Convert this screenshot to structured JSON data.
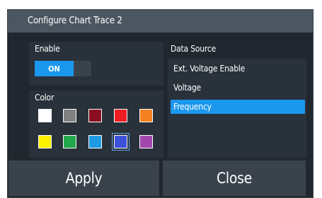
{
  "dialog": {
    "title": "Configure Chart Trace 2"
  },
  "enable": {
    "label": "Enable",
    "toggle_text": "ON",
    "state": true
  },
  "color": {
    "label": "Color",
    "swatches": [
      {
        "name": "white",
        "hex": "#ffffff"
      },
      {
        "name": "gray",
        "hex": "#808080"
      },
      {
        "name": "dark-red",
        "hex": "#8b0e1e"
      },
      {
        "name": "red",
        "hex": "#ee1d23"
      },
      {
        "name": "orange",
        "hex": "#f58220"
      },
      {
        "name": "yellow",
        "hex": "#fff200"
      },
      {
        "name": "green",
        "hex": "#21a84a"
      },
      {
        "name": "light-blue",
        "hex": "#1e9be3"
      },
      {
        "name": "blue",
        "hex": "#3c52d9"
      },
      {
        "name": "purple",
        "hex": "#a347ad"
      }
    ],
    "selected": "blue"
  },
  "data_source": {
    "label": "Data Source",
    "items": [
      "Ext. Voltage Enable",
      "Voltage",
      "Frequency"
    ],
    "selected": "Frequency"
  },
  "buttons": {
    "apply": "Apply",
    "close": "Close"
  },
  "colors": {
    "accent": "#1b97ee",
    "dialog_bg": "#20272e",
    "panel_bg": "#29313a",
    "titlebar_bg": "#4b5660",
    "button_bg": "#3a434c"
  }
}
